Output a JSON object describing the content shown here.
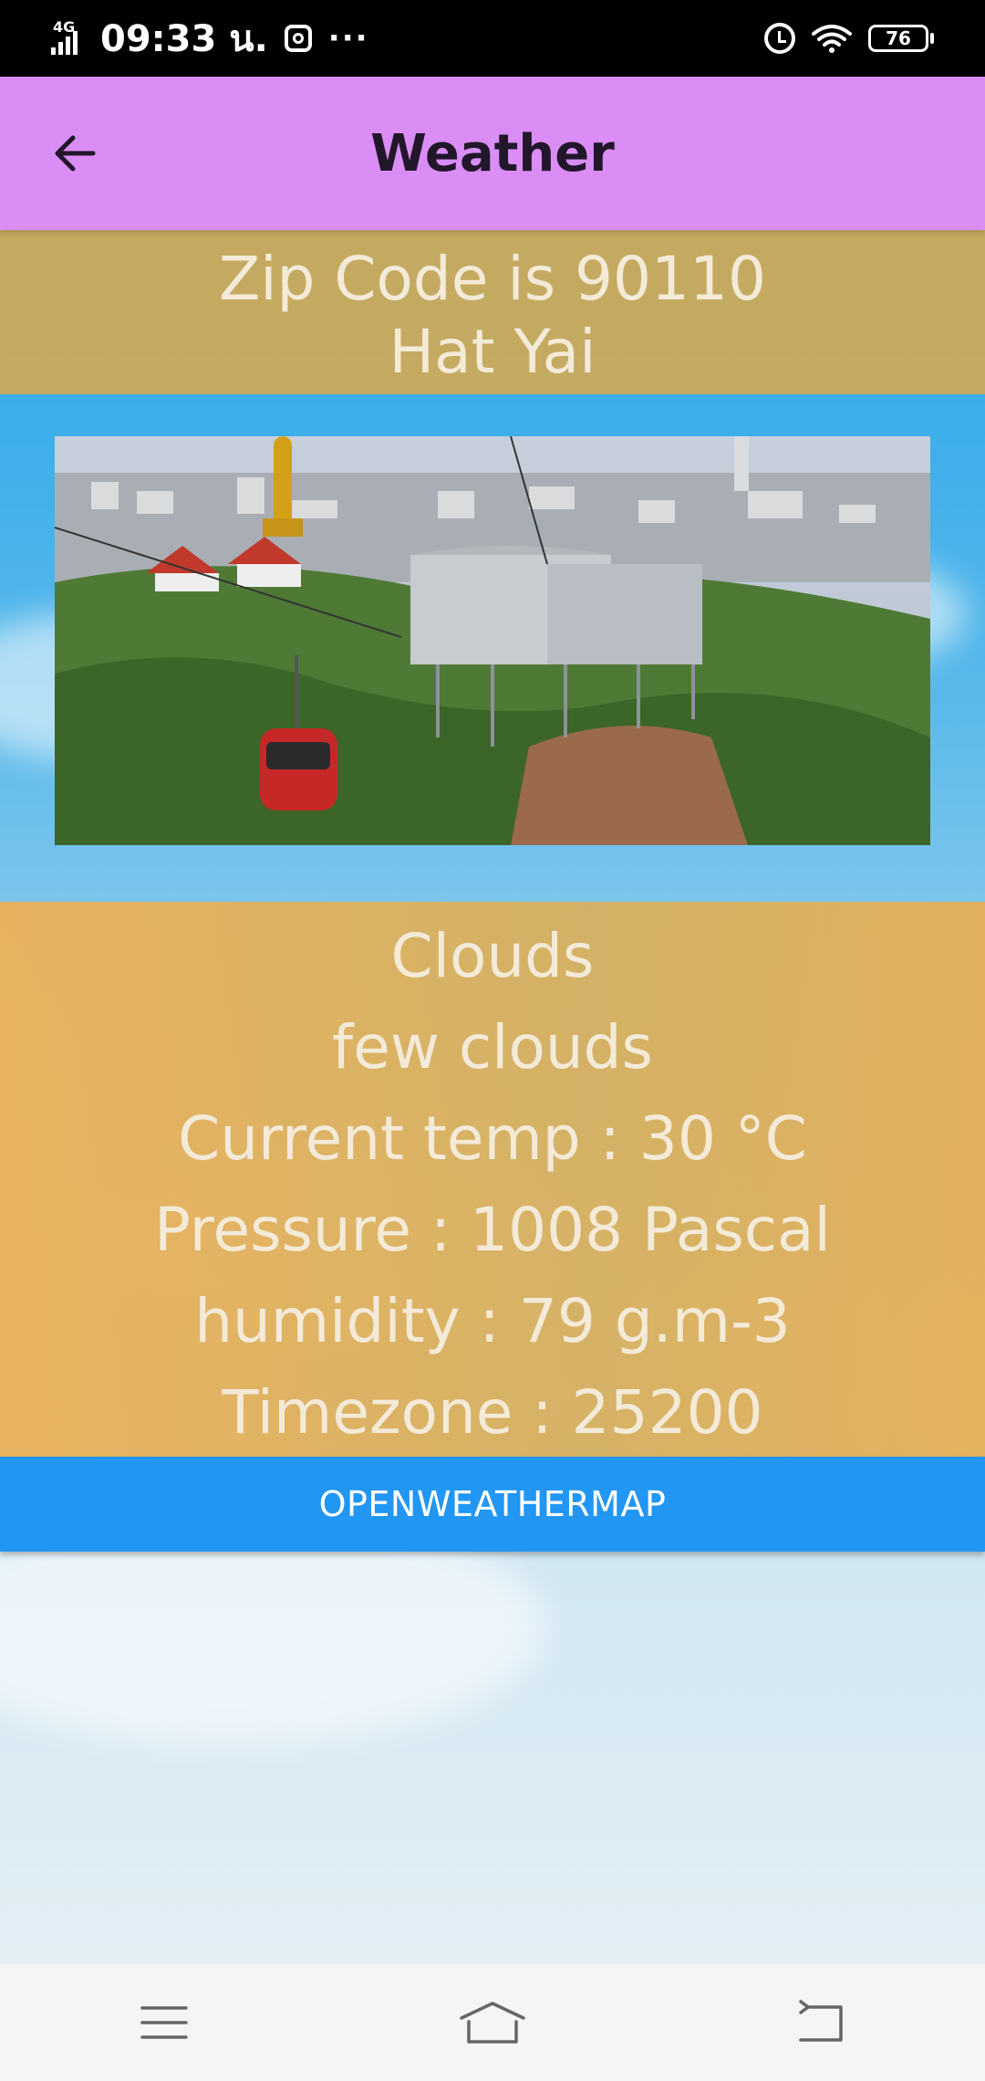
{
  "status_bar": {
    "network": "4G",
    "time": "09:33 น.",
    "more": "···",
    "battery": "76"
  },
  "app_bar": {
    "title": "Weather"
  },
  "location": {
    "zip_line": "Zip Code is 90110",
    "city": "Hat Yai"
  },
  "weather": {
    "main": "Clouds",
    "description": "few clouds",
    "temp": "Current temp : 30 °C",
    "pressure": "Pressure : 1008 Pascal",
    "humidity": "humidity : 79 g.m-3",
    "timezone": "Timezone : 25200"
  },
  "button": {
    "label": "OPENWEATHERMAP"
  },
  "colors": {
    "app_bar": "#da8ef5",
    "panel": "#d6b060",
    "button": "#2196f3"
  },
  "icons": {
    "back": "arrow-left-icon",
    "menu": "menu-icon",
    "home": "home-icon",
    "return": "return-icon"
  }
}
